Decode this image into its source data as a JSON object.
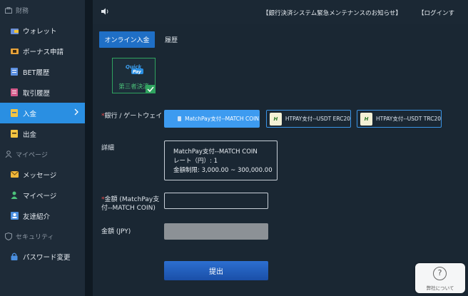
{
  "sidebar": {
    "sections": [
      {
        "label": "財務",
        "icon": "finance-icon"
      },
      {
        "label": "マイページ",
        "icon": "user-icon"
      },
      {
        "label": "セキュリティ",
        "icon": "shield-icon"
      }
    ],
    "items": [
      {
        "label": "ウォレット",
        "icon": "wallet-icon"
      },
      {
        "label": "ボーナス申請",
        "icon": "bonus-icon"
      },
      {
        "label": "BET履歴",
        "icon": "bet-history-icon"
      },
      {
        "label": "取引履歴",
        "icon": "transaction-icon"
      },
      {
        "label": "入金",
        "icon": "deposit-icon"
      },
      {
        "label": "出金",
        "icon": "withdraw-icon"
      },
      {
        "label": "メッセージ",
        "icon": "mail-icon"
      },
      {
        "label": "マイページ",
        "icon": "person-icon"
      },
      {
        "label": "友達紹介",
        "icon": "invite-icon"
      },
      {
        "label": "パスワード変更",
        "icon": "lock-icon"
      }
    ],
    "active_item": "入金"
  },
  "header": {
    "notice": "【銀行決済システム緊急メンテナンスのお知らせ】",
    "login": "【ログインす"
  },
  "tabs": [
    {
      "label": "オンライン入金",
      "active": true
    },
    {
      "label": "履歴",
      "active": false
    }
  ],
  "quickpay": {
    "logo_text_1": "Quick",
    "logo_text_2": "Pay",
    "label": "第三者決済"
  },
  "form": {
    "gateway_label": "銀行 / ゲートウェイ",
    "gateways": [
      {
        "label": "MatchPay支付--MATCH COIN",
        "selected": true
      },
      {
        "label": "HTPAY支付--USDT ERC20",
        "selected": false,
        "logo": "H"
      },
      {
        "label": "HTPAY支付--USDT TRC20",
        "selected": false,
        "logo": "H"
      }
    ],
    "detail_label": "詳細",
    "detail": {
      "line1": "MatchPay支付--MATCH COIN",
      "line2": "レート（円）: 1",
      "line3": "金額制限: 3,000.00 ~ 300,000.00"
    },
    "amount_label_1": "金額 (MatchPay支",
    "amount_label_2": "付--MATCH COIN)",
    "jpy_label": "金額 (JPY)",
    "submit_label": "提出"
  },
  "about": {
    "label": "弊社について",
    "icon": "question-icon"
  },
  "colors": {
    "accent": "#2a8fe2",
    "success": "#2fa35f",
    "required": "#e84b4b"
  }
}
